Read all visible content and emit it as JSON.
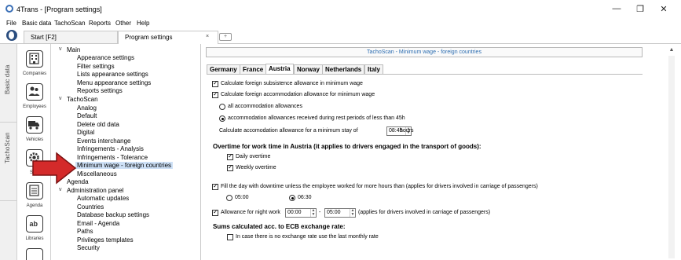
{
  "window": {
    "title": "4Trans - [Program settings]",
    "controls": {
      "minimize": "—",
      "restore": "❐",
      "close": "✕"
    }
  },
  "menu": [
    "File",
    "Basic data",
    "TachoScan",
    "Reports",
    "Other",
    "Help"
  ],
  "tabs": {
    "start": "Start [F2]",
    "active": "Program settings",
    "close": "×",
    "add": "+"
  },
  "vstrip": {
    "basic": "Basic data",
    "tacho": "TachoScan"
  },
  "sidebar": [
    {
      "label": "Companies",
      "icon": "building-icon"
    },
    {
      "label": "Employees",
      "icon": "people-icon"
    },
    {
      "label": "Vehicles",
      "icon": "truck-icon"
    },
    {
      "label": "Setti",
      "icon": "gear-icon"
    },
    {
      "label": "Agenda",
      "icon": "agenda-icon"
    },
    {
      "label": "Libraries",
      "icon": "library-icon"
    }
  ],
  "tree": {
    "main": "Main",
    "main_items": [
      "Appearance settings",
      "Filter settings",
      "Lists appearance settings",
      "Menu appearance settings",
      "Reports settings"
    ],
    "tachoscan": "TachoScan",
    "tacho_items": [
      "Analog",
      "Default",
      "Delete old data",
      "Digital",
      "Events interchange",
      "Infringements - Analysis",
      "Infringements - Tolerance",
      "Minimum wage - foreign countries",
      "Miscellaneous"
    ],
    "agenda": "Agenda",
    "admin": "Administration panel",
    "admin_items": [
      "Automatic updates",
      "Countries",
      "Database backup settings",
      "Email - Agenda",
      "Paths",
      "Privileges templates",
      "Security"
    ]
  },
  "content": {
    "banner": "TachoScan - Minimum wage - foreign countries",
    "country_tabs": [
      "Germany",
      "France",
      "Austria",
      "Norway",
      "Netherlands",
      "Italy"
    ],
    "active_tab": "Austria",
    "opt_subsistence": "Calculate foreign subsistence allowance in minimum wage",
    "opt_accommodation": "Calculate foreign accommodation allowance for minimum wage",
    "radio_all": "all accommodation allowances",
    "radio_rest": "accommodation allowances received during rest periods of less than 45h",
    "min_stay_label": "Calculate accomodation allowance for a minimum stay of",
    "min_stay_value": "08:45",
    "min_stay_unit": "hours",
    "overtime_heading": "Overtime for work time in Austria (it applies to drivers engaged in the transport of goods):",
    "daily_overtime": "Daily overtime",
    "weekly_overtime": "Weekly overtime",
    "fill_day": "Fill the day with downtime unless the employee worked for more hours than (applies for drivers involved in carriage of passengers)",
    "radio_0500": "05:00",
    "radio_0630": "06:30",
    "night_work": "Allowance for night work",
    "night_from": "00:00",
    "night_sep": "-",
    "night_to": "05:00",
    "night_note": "(applies for drivers involved in carriage of passengers)",
    "ecb_heading": "Sums calculated acc. to ECB exchange rate:",
    "ecb_option": "In case there is no exchange rate use the last monthly rate"
  }
}
